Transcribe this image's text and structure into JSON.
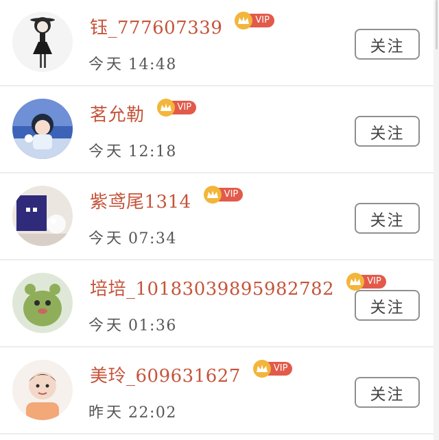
{
  "list": {
    "items": [
      {
        "username": "钰_777607339",
        "vip_label": "VIP",
        "vip_icon": "crown-icon",
        "day": "今天",
        "clock": "14:48",
        "follow_label": "关注"
      },
      {
        "username": "茗允勒",
        "vip_label": "VIP",
        "vip_icon": "crown-icon",
        "day": "今天",
        "clock": "12:18",
        "follow_label": "关注"
      },
      {
        "username": "紫鸢尾1314",
        "vip_label": "VIP",
        "vip_icon": "crown-icon",
        "day": "今天",
        "clock": "07:34",
        "follow_label": "关注"
      },
      {
        "username": "培培_10183039895982782",
        "vip_label": "VIP",
        "vip_icon": "crown-icon",
        "day": "今天",
        "clock": "01:36",
        "follow_label": "关注"
      },
      {
        "username": "美玲_609631627",
        "vip_label": "VIP",
        "vip_icon": "crown-icon",
        "day": "昨天",
        "clock": "22:02",
        "follow_label": "关注"
      }
    ]
  },
  "colors": {
    "username": "#c5543a",
    "vip_label_bg": "#e25a4a",
    "vip_crown_bg": "#f3b53a",
    "time_text": "#555555",
    "button_border": "#8f8f8f",
    "divider": "#ececec"
  }
}
